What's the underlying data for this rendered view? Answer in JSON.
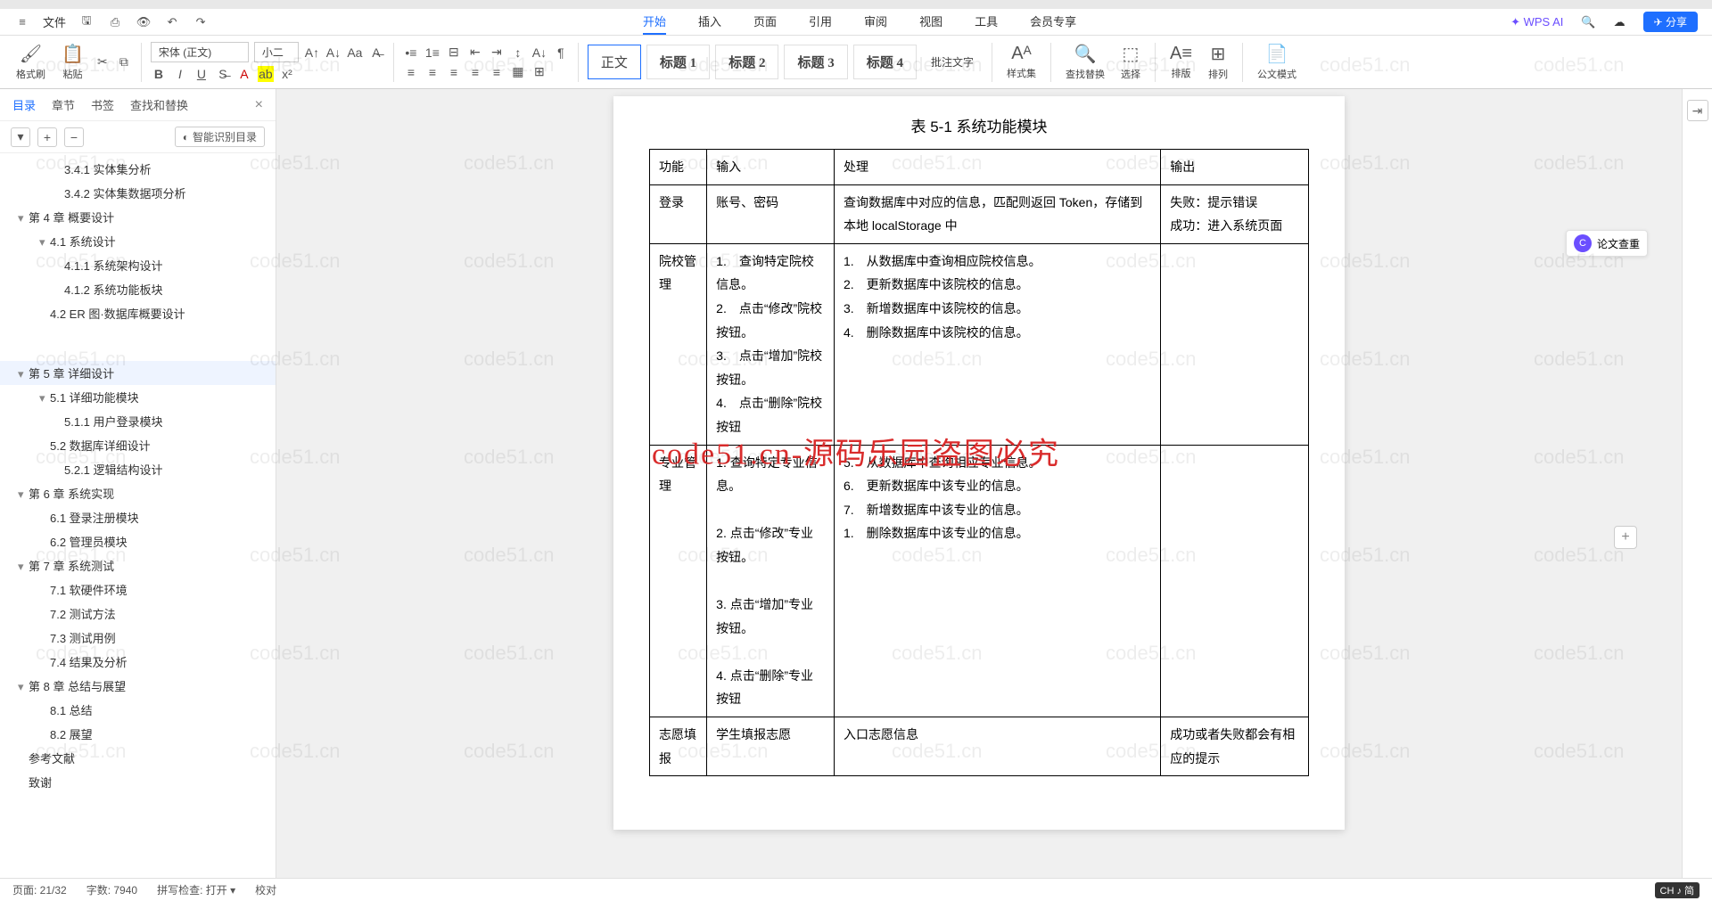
{
  "menubar": {
    "file": "文件",
    "tabs": [
      "开始",
      "插入",
      "页面",
      "引用",
      "审阅",
      "视图",
      "工具",
      "会员专享"
    ],
    "active_tab": 0,
    "wps_ai": "WPS AI",
    "share": "分享"
  },
  "ribbon": {
    "format_painter": "格式刷",
    "paste": "粘贴",
    "font_name": "宋体 (正文)",
    "font_size": "小二",
    "styles": {
      "body": "正文",
      "h1": "标题 1",
      "h2": "标题 2",
      "h3": "标题 3",
      "h4": "标题 4"
    },
    "comment": "批注文字",
    "style_set": "样式集",
    "find_replace": "查找替换",
    "select": "选择",
    "arrange": "排版",
    "sort": "排列",
    "gov_mode": "公文模式"
  },
  "nav": {
    "tabs": [
      "目录",
      "章节",
      "书签",
      "查找和替换"
    ],
    "active": 0,
    "ai_detect": "智能识别目录",
    "tree": [
      {
        "lvl": 3,
        "label": "3.4.1 实体集分析"
      },
      {
        "lvl": 3,
        "label": "3.4.2 实体集数据项分析"
      },
      {
        "lvl": 1,
        "label": "第 4 章 概要设计",
        "caret": true
      },
      {
        "lvl": 2,
        "label": "4.1 系统设计",
        "caret": true
      },
      {
        "lvl": 3,
        "label": "4.1.1 系统架构设计"
      },
      {
        "lvl": 3,
        "label": "4.1.2 系统功能板块"
      },
      {
        "lvl": 2,
        "label": "4.2 ER 图·数据库概要设计"
      },
      {
        "lvl": 1,
        "label": "第 5 章 详细设计",
        "caret": true,
        "sel": true
      },
      {
        "lvl": 2,
        "label": "5.1 详细功能模块",
        "caret": true
      },
      {
        "lvl": 3,
        "label": "5.1.1 用户登录模块"
      },
      {
        "lvl": 2,
        "label": "5.2 数据库详细设计"
      },
      {
        "lvl": 3,
        "label": "5.2.1 逻辑结构设计"
      },
      {
        "lvl": 1,
        "label": "第 6 章 系统实现",
        "caret": true
      },
      {
        "lvl": 2,
        "label": "6.1 登录注册模块"
      },
      {
        "lvl": 2,
        "label": "6.2 管理员模块"
      },
      {
        "lvl": 1,
        "label": "第 7 章 系统测试",
        "caret": true
      },
      {
        "lvl": 2,
        "label": "7.1 软硬件环境"
      },
      {
        "lvl": 2,
        "label": "7.2 测试方法"
      },
      {
        "lvl": 2,
        "label": "7.3 测试用例"
      },
      {
        "lvl": 2,
        "label": "7.4 结果及分析"
      },
      {
        "lvl": 1,
        "label": "第 8 章 总结与展望",
        "caret": true
      },
      {
        "lvl": 2,
        "label": "8.1 总结"
      },
      {
        "lvl": 2,
        "label": "8.2 展望"
      },
      {
        "lvl": 1,
        "label": "参考文献"
      },
      {
        "lvl": 1,
        "label": "致谢"
      }
    ]
  },
  "doc": {
    "caption": "表 5-1  系统功能模块",
    "headers": [
      "功能",
      "输入",
      "处理",
      "输出"
    ],
    "rows": [
      {
        "c0": "登录",
        "c1": "账号、密码",
        "c2": "查询数据库中对应的信息，匹配则返回 Token，存储到本地 localStorage 中",
        "c3": "失败：提示错误\n成功：进入系统页面"
      },
      {
        "c0": "院校管理",
        "c1": "1.　查询特定院校信息。\n2.　点击“修改”院校按钮。\n3.　点击“增加”院校按钮。\n4.　点击“删除”院校按钮",
        "c2": "1.　从数据库中查询相应院校信息。\n2.　更新数据库中该院校的信息。\n3.　新增数据库中该院校的信息。\n4.　删除数据库中该院校的信息。",
        "c3": ""
      },
      {
        "c0": "专业管理",
        "c1": "1. 查询特定专业信息。\n\n2. 点击“修改”专业按钮。\n\n3. 点击“增加”专业按钮。\n\n4. 点击“删除”专业按钮",
        "c2": "5.　从数据库中查询相应专业信息。\n6.　更新数据库中该专业的信息。\n7.　新增数据库中该专业的信息。\n1.　删除数据库中该专业的信息。",
        "c3": ""
      },
      {
        "c0": "志愿填报",
        "c1": "学生填报志愿",
        "c2": "入口志愿信息",
        "c3": "成功或者失败都会有相应的提示"
      }
    ]
  },
  "watermark": {
    "small": "code51.cn",
    "big": "code51.cn-源码乐园盗图必究"
  },
  "rail": {
    "paper_check": "论文查重"
  },
  "status": {
    "page": "页面: 21/32",
    "words": "字数: 7940",
    "spell": "拼写检查: 打开",
    "proof": "校对",
    "ime": "CH ♪ 简"
  }
}
